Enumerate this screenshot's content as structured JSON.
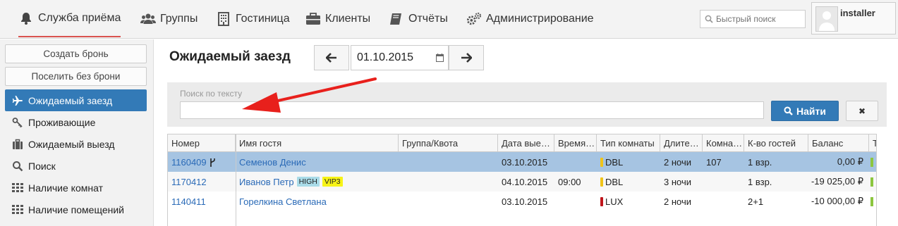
{
  "topnav": {
    "items": [
      {
        "label": "Служба приёма",
        "icon": "bell-icon",
        "active": true
      },
      {
        "label": "Группы",
        "icon": "users-icon"
      },
      {
        "label": "Гостиница",
        "icon": "building-icon"
      },
      {
        "label": "Клиенты",
        "icon": "briefcase-icon"
      },
      {
        "label": "Отчёты",
        "icon": "book-icon"
      },
      {
        "label": "Администрирование",
        "icon": "gears-icon"
      }
    ],
    "quick_search_placeholder": "Быстрый поиск",
    "user": "installer"
  },
  "sidebar": {
    "buttons": [
      "Создать бронь",
      "Поселить без брони"
    ],
    "items": [
      {
        "label": "Ожидаемый заезд",
        "icon": "plane-icon",
        "active": true
      },
      {
        "label": "Проживающие",
        "icon": "key-icon"
      },
      {
        "label": "Ожидаемый выезд",
        "icon": "suitcase-icon"
      },
      {
        "label": "Поиск",
        "icon": "search-icon"
      },
      {
        "label": "Наличие комнат",
        "icon": "grid-icon"
      },
      {
        "label": "Наличие помещений",
        "icon": "grid-icon"
      }
    ]
  },
  "main": {
    "title": "Ожидаемый заезд",
    "date": "01.10.2015",
    "search_label": "Поиск по тексту",
    "find_label": "Найти",
    "clear_symbol": "✖"
  },
  "table": {
    "columns": [
      "Номер",
      "Имя гостя",
      "Группа/Квота",
      "Дата выезда",
      "Время",
      "Тип комнаты",
      "Длительность",
      "Комната",
      "К-во гостей",
      "Баланс",
      "Т"
    ],
    "columns_display": [
      "Номер",
      "Имя гостя",
      "Группа/Квота",
      "Дата вые…",
      "Время…",
      "Тип комнаты",
      "Длите…",
      "Комна…",
      "К-во гостей",
      "Баланс",
      "Т"
    ],
    "rows": [
      {
        "number": "1160409",
        "guest": "Семенов Денис",
        "group": "",
        "checkout": "03.10.2015",
        "time": "",
        "room_type": "DBL",
        "room_color": "#f0c419",
        "nights": "2 ночи",
        "room": "107",
        "guests": "1 взр.",
        "balance": "0,00 ₽",
        "badges": [],
        "selected": true
      },
      {
        "number": "1170412",
        "guest": "Иванов Петр",
        "group": "",
        "checkout": "04.10.2015",
        "time": "09:00",
        "room_type": "DBL",
        "room_color": "#f0c419",
        "nights": "3 ночи",
        "room": "",
        "guests": "1 взр.",
        "balance": "-19 025,00 ₽",
        "badges": [
          {
            "label": "HIGH",
            "color": "#a9dbe8"
          },
          {
            "label": "VIP3",
            "color": "#f7f317"
          }
        ]
      },
      {
        "number": "1140411",
        "guest": "Горелкина Светлана",
        "group": "",
        "checkout": "03.10.2015",
        "time": "",
        "room_type": "LUX",
        "room_color": "#c0151b",
        "nights": "2 ночи",
        "room": "",
        "guests": "2+1",
        "balance": "-10 000,00 ₽",
        "badges": []
      }
    ]
  },
  "colors": {
    "accent": "#337ab7",
    "active_tab_underline": "#d9534f",
    "annotation_arrow": "#e8201c"
  }
}
